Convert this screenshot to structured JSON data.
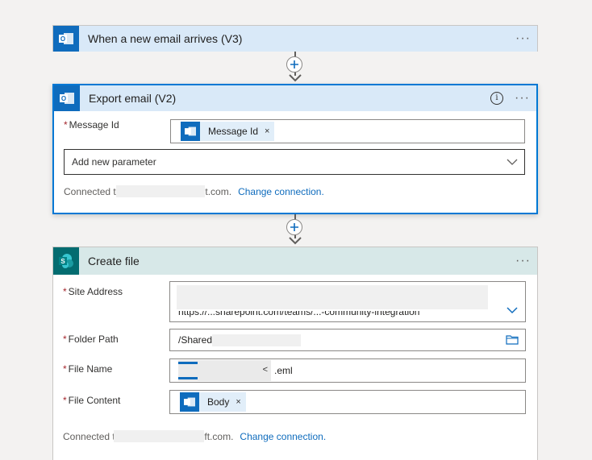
{
  "trigger": {
    "title": "When a new email arrives (V3)"
  },
  "export_email": {
    "title": "Export email (V2)",
    "message_id_label": "Message Id",
    "message_id_token": "Message Id",
    "add_parameter_placeholder": "Add new parameter",
    "connected_prefix": "Connected to",
    "connected_suffix": "t.com.",
    "change_connection": "Change connection."
  },
  "create_file": {
    "title": "Create file",
    "site_address_label": "Site Address",
    "site_address_partial": "https://...sharepoint.com/teams/...-community-integration",
    "folder_path_label": "Folder Path",
    "folder_path_value": "/Shared",
    "file_name_label": "File Name",
    "file_name_suffix": ".eml",
    "file_content_label": "File Content",
    "file_content_token": "Body",
    "connected_prefix": "Connected to",
    "connected_suffix": "ft.com.",
    "change_connection": "Change connection."
  },
  "glyphs": {
    "more": "···",
    "info": "i",
    "remove": "×",
    "required": "*"
  },
  "colors": {
    "accent": "#0078d4",
    "outlook": "#0f6cbd",
    "sharepoint": "#036c70",
    "link": "#0f6cbd"
  }
}
